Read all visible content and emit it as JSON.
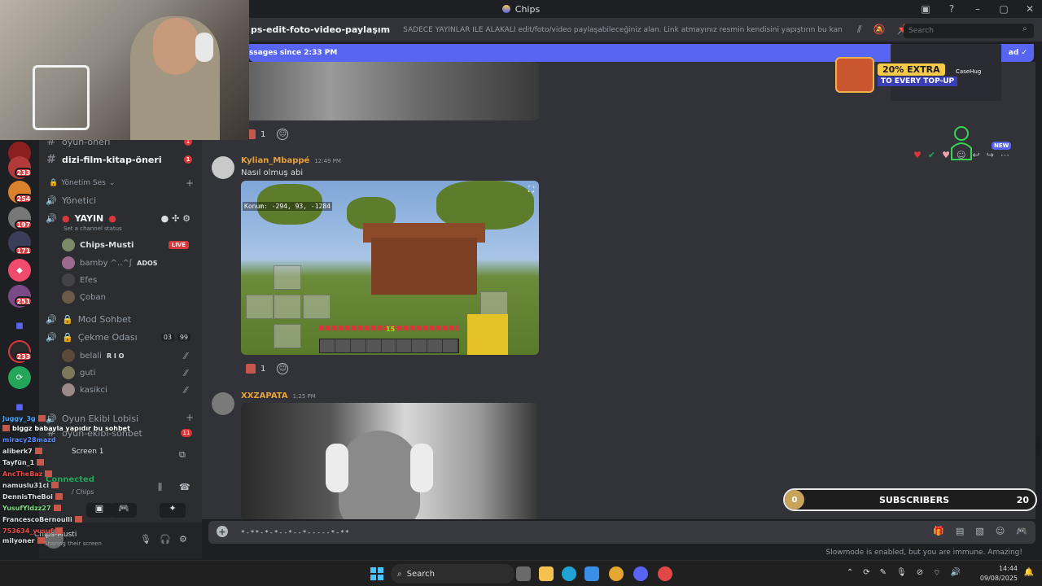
{
  "window": {
    "title": "Chips"
  },
  "rail": {
    "badges": [
      "233",
      "254",
      "197",
      "171",
      "251",
      "233"
    ]
  },
  "sidebar": {
    "channels": [
      {
        "name": "oyun-öneri",
        "unread": "1"
      },
      {
        "name": "dizi-film-kitap-öneri",
        "unread": "1"
      }
    ],
    "category": "Yönetim Ses",
    "voice_channels": {
      "yonetici": "Yönetici",
      "yayin": "YAYIN",
      "yayin_status": "Set a channel status",
      "mod": "Mod Sohbet",
      "cekme": "Çekme Odası",
      "cekme_count_a": "03",
      "cekme_count_b": "99"
    },
    "yayin_users": [
      {
        "name": "Chips-Musti",
        "tag": "LIVE"
      },
      {
        "name": "bamby ^..^ʃ",
        "tag": "ADOS"
      },
      {
        "name": "Efes",
        "tag": ""
      },
      {
        "name": "Çoban",
        "tag": ""
      }
    ],
    "cekme_users": [
      {
        "name": "belali",
        "tag": "R I O"
      },
      {
        "name": "guti",
        "tag": ""
      },
      {
        "name": "kasikci",
        "tag": ""
      }
    ],
    "lobby": "Oyun Ekibi Lobisi",
    "lobby_chat": "oyun-ekibi-sohbet",
    "lobby_unread": "11",
    "screen": "Screen 1",
    "connected": "Connected",
    "connected_path": "/ Chips",
    "user": {
      "name": "Chips-Musti",
      "status": "Sharing their screen"
    }
  },
  "stream_chat": [
    {
      "name": "Juggy_3g",
      "text": ""
    },
    {
      "name": "",
      "text": "biggz babayla yapıdır bu sohbet"
    },
    {
      "name": "miracy28mazd",
      "text": ""
    },
    {
      "name": "aliberk7",
      "text": ""
    },
    {
      "name": "Tayfün_1",
      "text": ""
    },
    {
      "name": "AncTheBaz",
      "text": ""
    },
    {
      "name": "namuslu31ci",
      "text": ""
    },
    {
      "name": "DennisTheBoi",
      "text": ""
    },
    {
      "name": "YusufYldzz27",
      "text": ""
    },
    {
      "name": "FrancescoBernoulli",
      "text": ""
    },
    {
      "name": "753634_yusuf",
      "text": ""
    },
    {
      "name": "milyoner",
      "text": ""
    }
  ],
  "header": {
    "channel": "ps-edit-foto-video-paylaşım",
    "topic": "SADECE YAYINLAR İLE ALAKALI edit/foto/video paylaşabileceğiniz alan. Link atmayınız resmin kendisini yapıştırın bu kanala lütfen, ...",
    "search_placeholder": "Search"
  },
  "new_messages": {
    "text": "ssages since 2:33 PM",
    "right": "ad"
  },
  "messages": [
    {
      "author": "Kylian_Mbappé",
      "time": "12:49 PM",
      "text": "Nasıl olmuş abi",
      "author_color": "#e8a13a",
      "reaction_count": "1"
    },
    {
      "author": "XXZAPATA",
      "time": "1:25 PM",
      "text": "",
      "author_color": "#e8a13a"
    }
  ],
  "first_reaction_count": "1",
  "minecraft": {
    "coords": "Konum: -294, 93, -1284",
    "level": "15"
  },
  "ad": {
    "headline": "20% EXTRA",
    "sub": "TO EVERY TOP-UP",
    "brand": "CaseHug"
  },
  "new_tag": "NEW",
  "subscribers": {
    "current": "0",
    "label": "SUBSCRIBERS",
    "goal": "20"
  },
  "composer": {
    "value": "*-**-*-*--*--*-----*-**"
  },
  "slowmode": "Slowmode is enabled, but you are immune. Amazing!",
  "taskbar": {
    "search": "Search",
    "time": "14:44",
    "date": "09/08/2025"
  }
}
